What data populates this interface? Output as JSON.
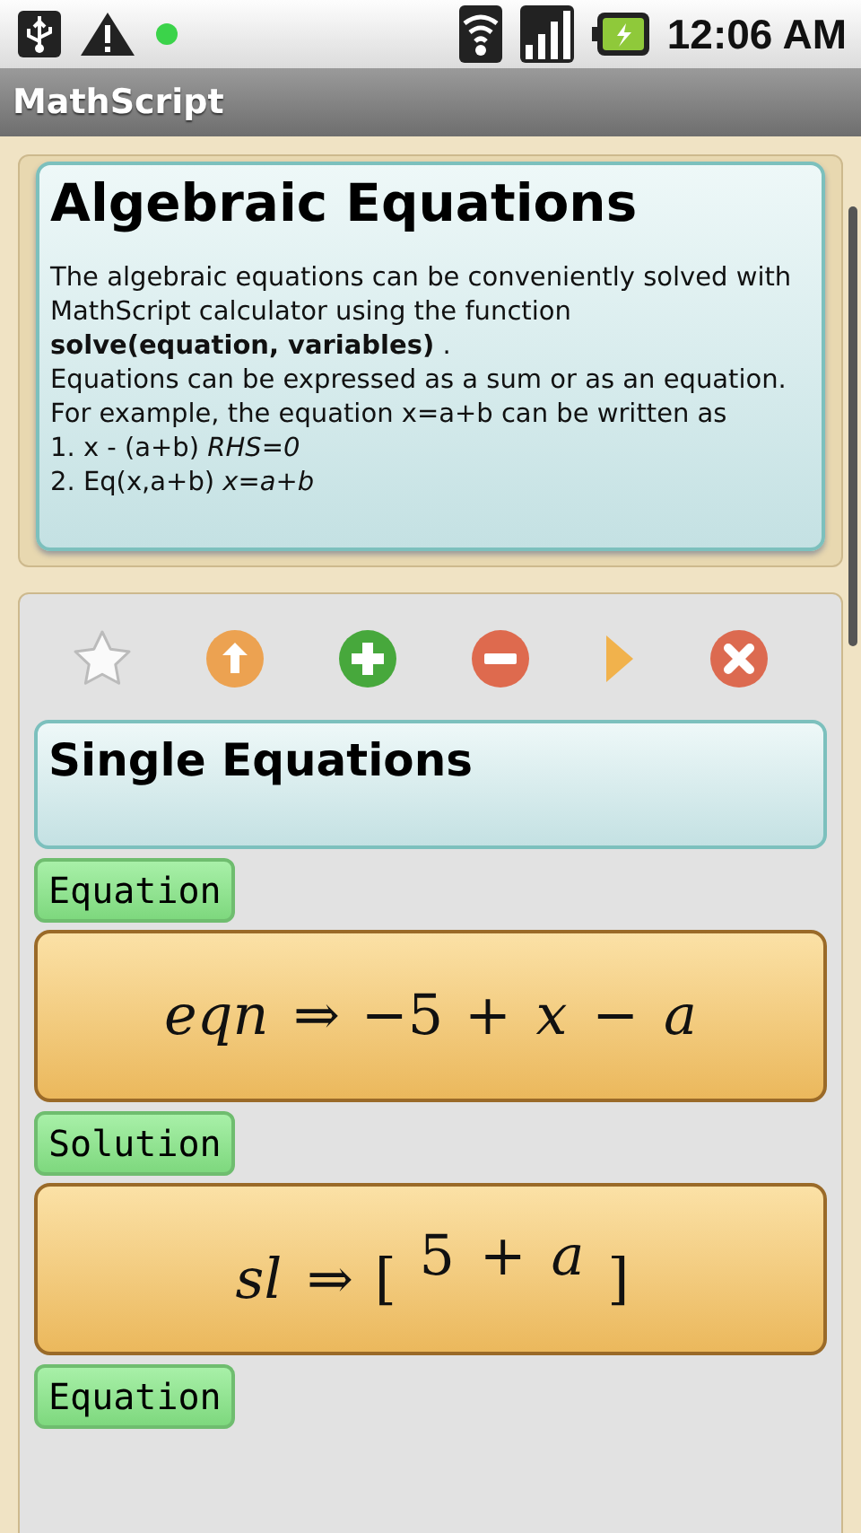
{
  "status_bar": {
    "time": "12:06 AM"
  },
  "app_bar": {
    "title": "MathScript"
  },
  "intro": {
    "heading": "Algebraic Equations",
    "lines": [
      {
        "text": "The algebraic equations can be conveniently solved with MathScript calculator using the function"
      },
      {
        "text": "**solve(equation, variables)** ."
      },
      {
        "text": "Equations can be expressed as a sum or as an equation."
      },
      {
        "text": "For example, the equation x=a+b can be written as"
      },
      {
        "text": "1. x - (a+b) *RHS=0*"
      },
      {
        "text": "2. Eq(x,a+b) *x=a+b*"
      }
    ]
  },
  "toolbar": [
    {
      "kind": "star"
    },
    {
      "kind": "up"
    },
    {
      "kind": "add"
    },
    {
      "kind": "remove"
    },
    {
      "kind": "play"
    },
    {
      "kind": "close"
    }
  ],
  "worksheet": {
    "heading": "Single Equations",
    "blocks": [
      {
        "label": "Equation",
        "formula": [
          {
            "text": "eqn",
            "kind": "var"
          },
          {
            "text": "⇒",
            "kind": "sym"
          },
          {
            "text": "−5",
            "kind": "sym"
          },
          {
            "text": "+",
            "kind": "sym"
          },
          {
            "text": "x",
            "kind": "var"
          },
          {
            "text": "−",
            "kind": "sym"
          },
          {
            "text": "a",
            "kind": "var"
          }
        ]
      },
      {
        "label": "Solution",
        "formula": [
          {
            "text": "sl",
            "kind": "var"
          },
          {
            "text": "⇒",
            "kind": "sym"
          },
          {
            "text": "[",
            "kind": "sym"
          },
          {
            "text": "5",
            "kind": "raised-sym"
          },
          {
            "text": "+",
            "kind": "raised-sym"
          },
          {
            "text": "a",
            "kind": "raised-var"
          },
          {
            "text": "]",
            "kind": "sym"
          }
        ]
      },
      {
        "label": "Equation"
      }
    ]
  }
}
